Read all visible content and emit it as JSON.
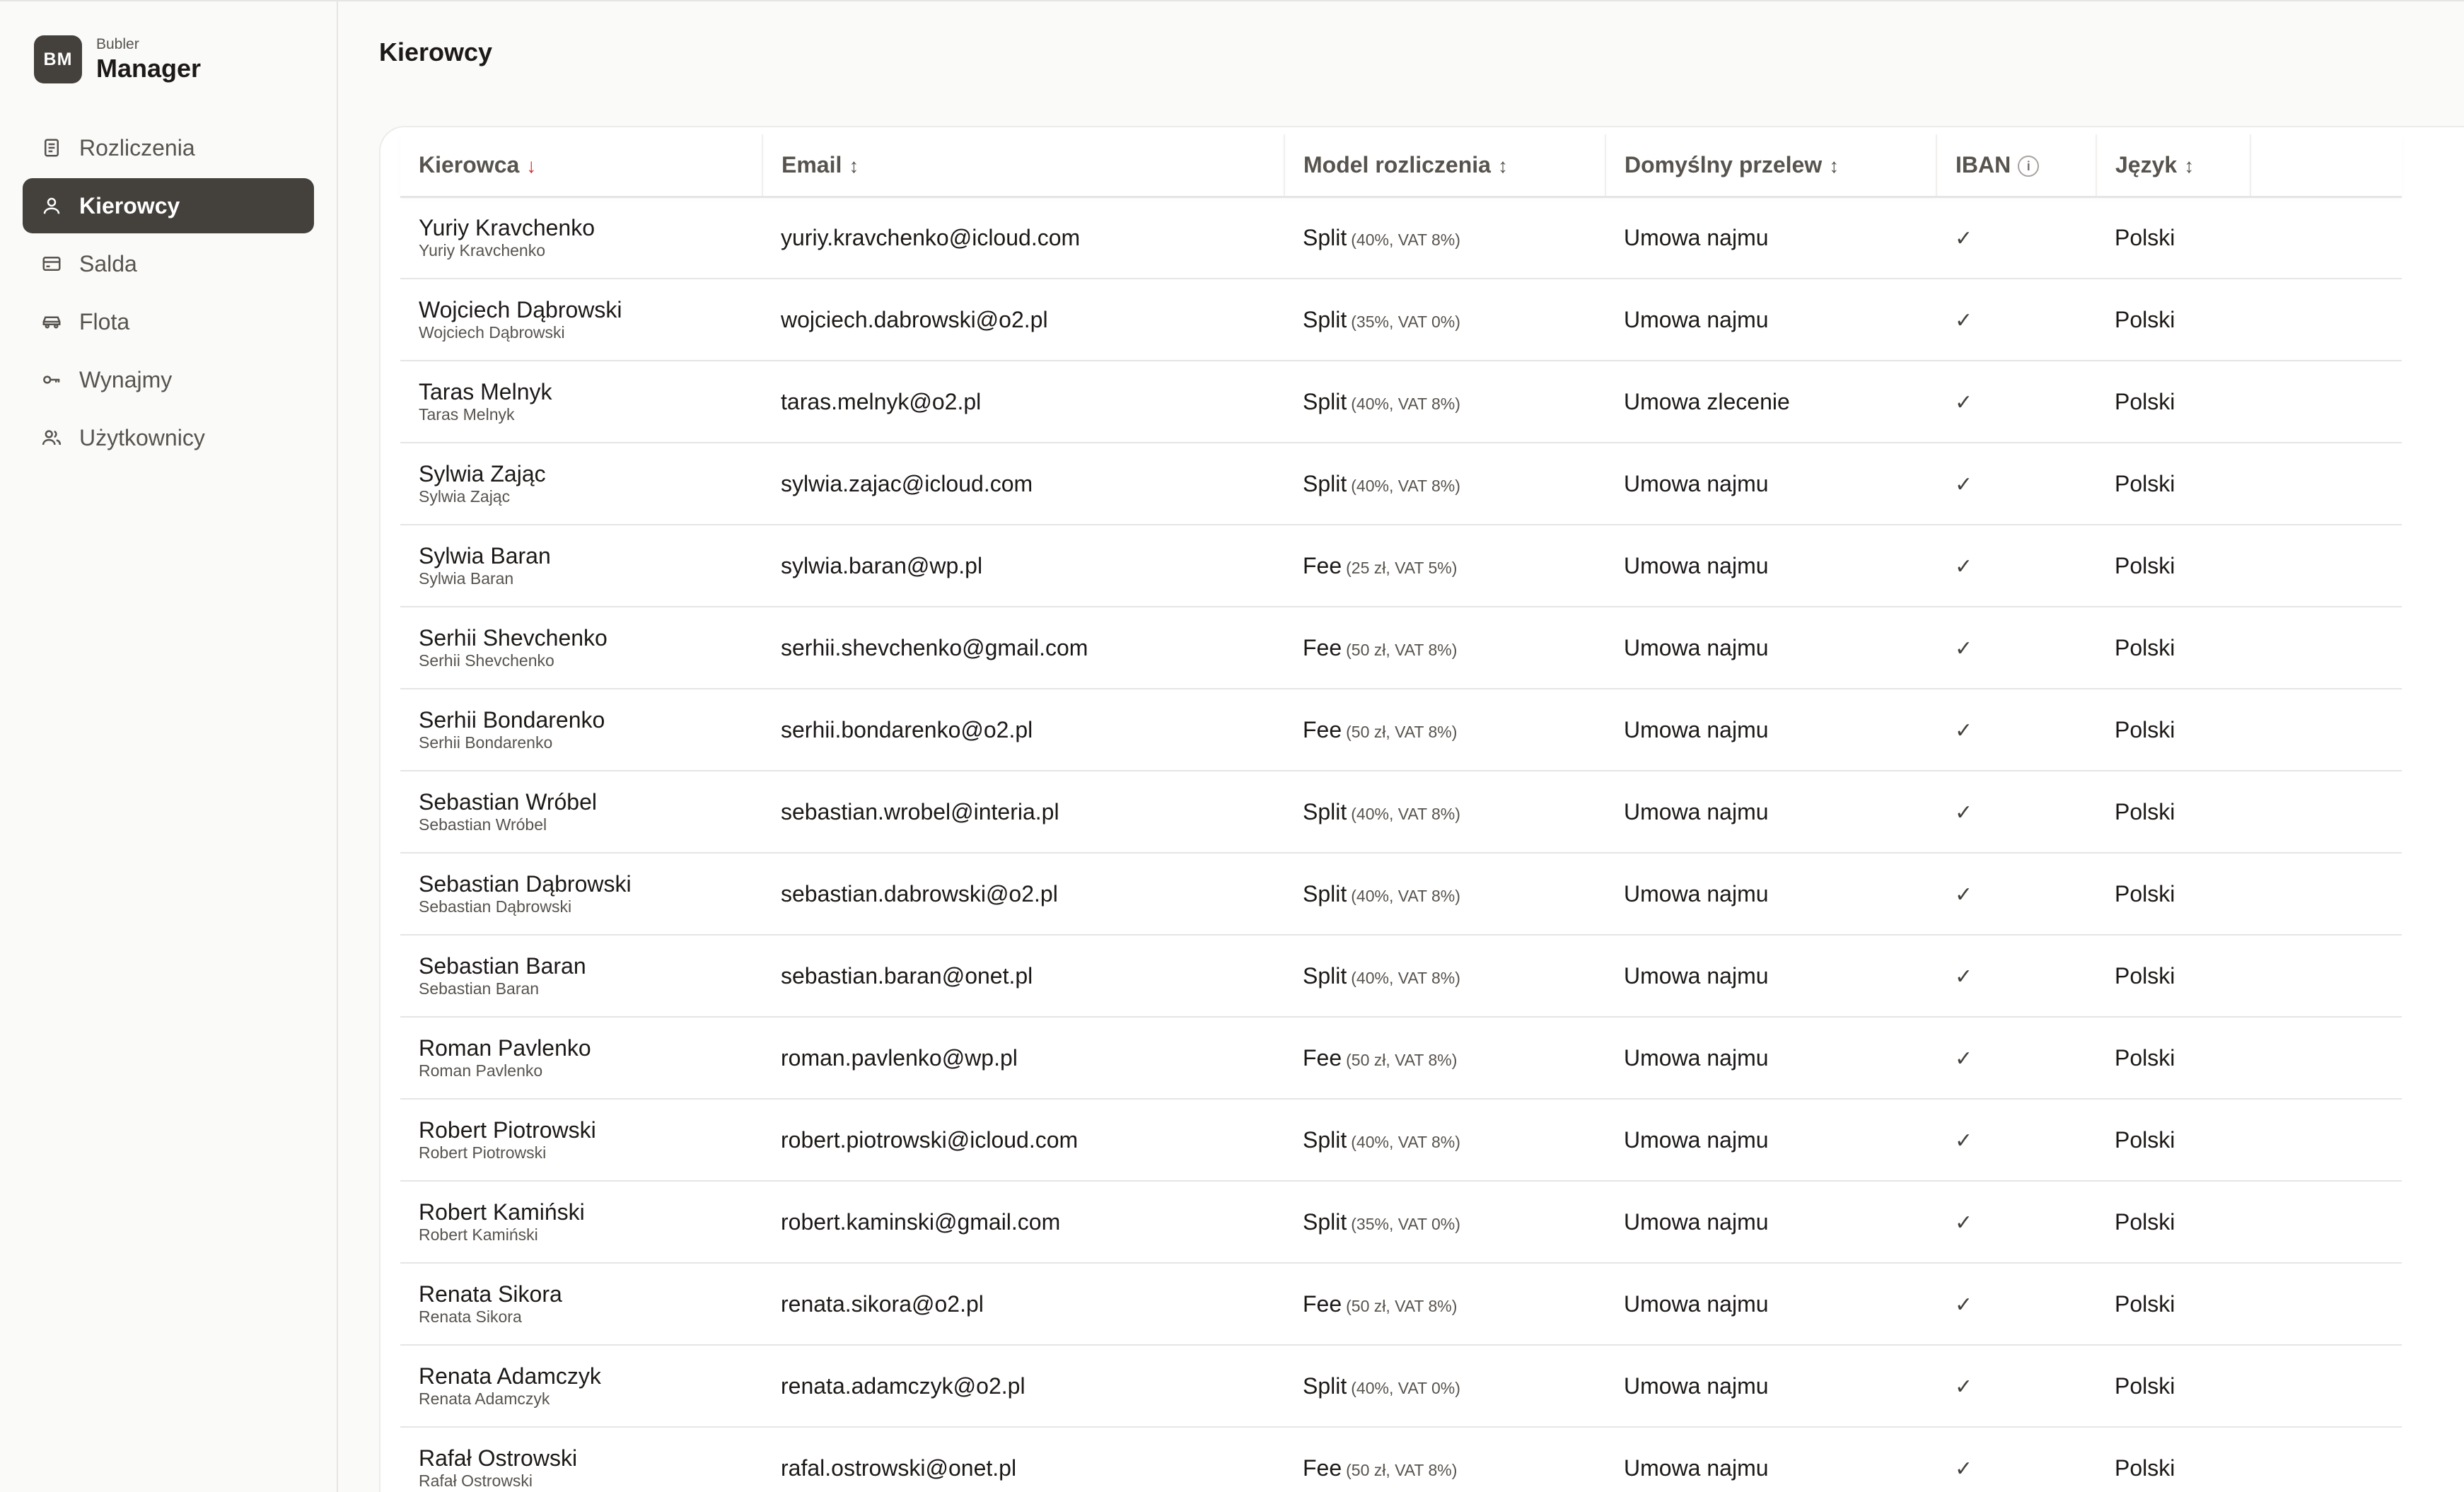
{
  "brand": {
    "logo": "BM",
    "small": "Bubler",
    "big": "Manager"
  },
  "nav": [
    {
      "label": "Rozliczenia",
      "icon": "document-icon",
      "active": false
    },
    {
      "label": "Kierowcy",
      "icon": "user-icon",
      "active": true
    },
    {
      "label": "Salda",
      "icon": "wallet-icon",
      "active": false
    },
    {
      "label": "Flota",
      "icon": "car-icon",
      "active": false
    },
    {
      "label": "Wynajmy",
      "icon": "key-icon",
      "active": false
    },
    {
      "label": "Użytkownicy",
      "icon": "users-icon",
      "active": false
    }
  ],
  "page": {
    "title": "Kierowcy"
  },
  "table": {
    "columns": [
      {
        "label": "Kierowca",
        "sort": "↓"
      },
      {
        "label": "Email",
        "sort": "↕"
      },
      {
        "label": "Model rozliczenia",
        "sort": "↕"
      },
      {
        "label": "Domyślny przelew",
        "sort": "↕"
      },
      {
        "label": "IBAN",
        "info": "i"
      },
      {
        "label": "Język",
        "sort": "↕"
      }
    ],
    "check_glyph": "✓",
    "rows": [
      {
        "name": "Yuriy Kravchenko",
        "sub": "Yuriy Kravchenko",
        "email": "yuriy.kravchenko@icloud.com",
        "model": "Split",
        "model_detail": "(40%, VAT 8%)",
        "transfer": "Umowa najmu",
        "iban": true,
        "lang": "Polski"
      },
      {
        "name": "Wojciech Dąbrowski",
        "sub": "Wojciech Dąbrowski",
        "email": "wojciech.dabrowski@o2.pl",
        "model": "Split",
        "model_detail": "(35%, VAT 0%)",
        "transfer": "Umowa najmu",
        "iban": true,
        "lang": "Polski"
      },
      {
        "name": "Taras Melnyk",
        "sub": "Taras Melnyk",
        "email": "taras.melnyk@o2.pl",
        "model": "Split",
        "model_detail": "(40%, VAT 8%)",
        "transfer": "Umowa zlecenie",
        "iban": true,
        "lang": "Polski"
      },
      {
        "name": "Sylwia Zając",
        "sub": "Sylwia Zając",
        "email": "sylwia.zajac@icloud.com",
        "model": "Split",
        "model_detail": "(40%, VAT 8%)",
        "transfer": "Umowa najmu",
        "iban": true,
        "lang": "Polski"
      },
      {
        "name": "Sylwia Baran",
        "sub": "Sylwia Baran",
        "email": "sylwia.baran@wp.pl",
        "model": "Fee",
        "model_detail": "(25 zł, VAT 5%)",
        "transfer": "Umowa najmu",
        "iban": true,
        "lang": "Polski"
      },
      {
        "name": "Serhii Shevchenko",
        "sub": "Serhii Shevchenko",
        "email": "serhii.shevchenko@gmail.com",
        "model": "Fee",
        "model_detail": "(50 zł, VAT 8%)",
        "transfer": "Umowa najmu",
        "iban": true,
        "lang": "Polski"
      },
      {
        "name": "Serhii Bondarenko",
        "sub": "Serhii Bondarenko",
        "email": "serhii.bondarenko@o2.pl",
        "model": "Fee",
        "model_detail": "(50 zł, VAT 8%)",
        "transfer": "Umowa najmu",
        "iban": true,
        "lang": "Polski"
      },
      {
        "name": "Sebastian Wróbel",
        "sub": "Sebastian Wróbel",
        "email": "sebastian.wrobel@interia.pl",
        "model": "Split",
        "model_detail": "(40%, VAT 8%)",
        "transfer": "Umowa najmu",
        "iban": true,
        "lang": "Polski"
      },
      {
        "name": "Sebastian Dąbrowski",
        "sub": "Sebastian Dąbrowski",
        "email": "sebastian.dabrowski@o2.pl",
        "model": "Split",
        "model_detail": "(40%, VAT 8%)",
        "transfer": "Umowa najmu",
        "iban": true,
        "lang": "Polski"
      },
      {
        "name": "Sebastian Baran",
        "sub": "Sebastian Baran",
        "email": "sebastian.baran@onet.pl",
        "model": "Split",
        "model_detail": "(40%, VAT 8%)",
        "transfer": "Umowa najmu",
        "iban": true,
        "lang": "Polski"
      },
      {
        "name": "Roman Pavlenko",
        "sub": "Roman Pavlenko",
        "email": "roman.pavlenko@wp.pl",
        "model": "Fee",
        "model_detail": "(50 zł, VAT 8%)",
        "transfer": "Umowa najmu",
        "iban": true,
        "lang": "Polski"
      },
      {
        "name": "Robert Piotrowski",
        "sub": "Robert Piotrowski",
        "email": "robert.piotrowski@icloud.com",
        "model": "Split",
        "model_detail": "(40%, VAT 8%)",
        "transfer": "Umowa najmu",
        "iban": true,
        "lang": "Polski"
      },
      {
        "name": "Robert Kamiński",
        "sub": "Robert Kamiński",
        "email": "robert.kaminski@gmail.com",
        "model": "Split",
        "model_detail": "(35%, VAT 0%)",
        "transfer": "Umowa najmu",
        "iban": true,
        "lang": "Polski"
      },
      {
        "name": "Renata Sikora",
        "sub": "Renata Sikora",
        "email": "renata.sikora@o2.pl",
        "model": "Fee",
        "model_detail": "(50 zł, VAT 8%)",
        "transfer": "Umowa najmu",
        "iban": true,
        "lang": "Polski"
      },
      {
        "name": "Renata Adamczyk",
        "sub": "Renata Adamczyk",
        "email": "renata.adamczyk@o2.pl",
        "model": "Split",
        "model_detail": "(40%, VAT 0%)",
        "transfer": "Umowa najmu",
        "iban": true,
        "lang": "Polski"
      },
      {
        "name": "Rafał Ostrowski",
        "sub": "Rafał Ostrowski",
        "email": "rafal.ostrowski@onet.pl",
        "model": "Fee",
        "model_detail": "(50 zł, VAT 8%)",
        "transfer": "Umowa najmu",
        "iban": true,
        "lang": "Polski"
      }
    ]
  },
  "colors": {
    "sidebar_active": "#44403c",
    "sort_active": "#dc2626",
    "background": "#fafaf9"
  }
}
